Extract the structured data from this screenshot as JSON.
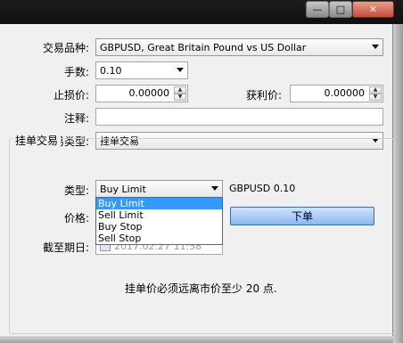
{
  "window": {
    "minimize_glyph": "—",
    "maximize_glyph": "□",
    "close_glyph": "✕"
  },
  "form": {
    "symbol_label": "交易品种:",
    "symbol_value": "GBPUSD, Great Britain Pound vs US Dollar",
    "volume_label": "手数:",
    "volume_value": "0.10",
    "stoploss_label": "止损价:",
    "stoploss_value": "0.00000",
    "takeprofit_label": "获利价:",
    "takeprofit_value": "0.00000",
    "comment_label": "注释:",
    "comment_value": "",
    "order_type_label": "交易类型:",
    "order_type_value": "挂单交易"
  },
  "pending": {
    "group_title": "挂单交易",
    "type_label": "类型:",
    "type_value": "Buy Limit",
    "type_options": [
      "Buy Limit",
      "Sell Limit",
      "Buy Stop",
      "Sell Stop"
    ],
    "price_label": "价格:",
    "expiry_label": "截至期日:",
    "expiry_value": "2017.02.27 11:58",
    "status_text": "GBPUSD 0.10",
    "place_button": "下单",
    "note": "挂单价必须远离市价至少 20 点."
  }
}
